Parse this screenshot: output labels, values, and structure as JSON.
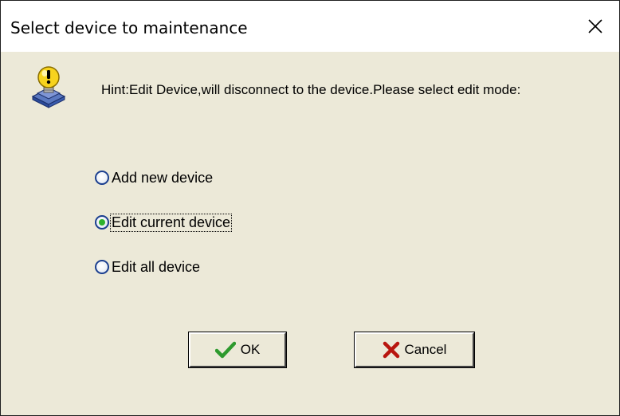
{
  "window": {
    "title": "Select device to maintenance",
    "close_glyph": "✕"
  },
  "hint": {
    "icon": "lightbulb-warning-icon",
    "text": "Hint:Edit Device,will disconnect to the device.Please select edit mode:"
  },
  "edit_mode": {
    "options": [
      {
        "label": "Add new device",
        "checked": false
      },
      {
        "label": "Edit current device",
        "checked": true
      },
      {
        "label": "Edit all device",
        "checked": false
      }
    ],
    "selected": "Edit current device"
  },
  "buttons": {
    "ok_label": "OK",
    "ok_icon": "checkmark-icon",
    "cancel_label": "Cancel",
    "cancel_icon": "x-icon"
  },
  "colors": {
    "dialog_bg": "#ece9d8",
    "radio_border": "#1b3f8f",
    "radio_selected_dot": "#2db22d",
    "ok_check": "#2e9a2e",
    "cancel_x": "#b8160f"
  }
}
